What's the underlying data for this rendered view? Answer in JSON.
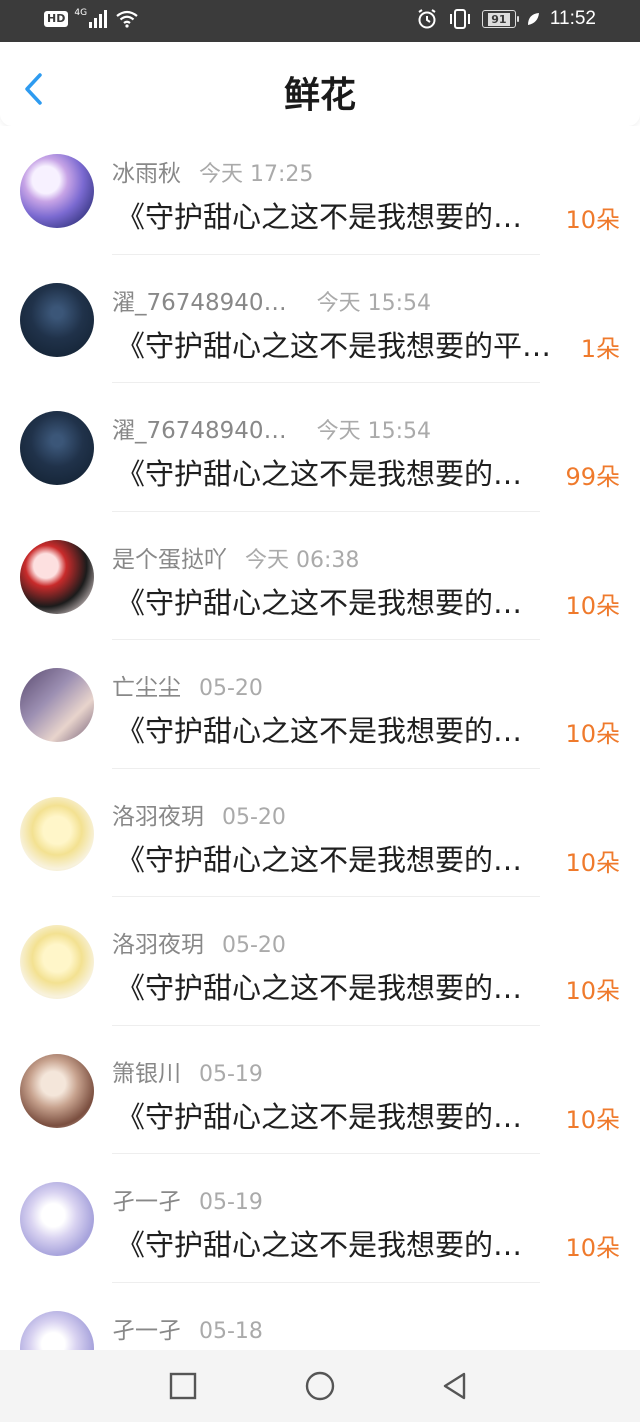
{
  "status_bar": {
    "hd": "HD",
    "network": "4G",
    "battery": "91",
    "time": "11:52"
  },
  "header": {
    "title": "鲜花"
  },
  "rows": [
    {
      "name": "冰雨秋",
      "time": "今天 17:25",
      "message": "《守护甜心之这不是我想要的…",
      "count": "10朵",
      "avatar": "av-1"
    },
    {
      "name": "濯_76748940…",
      "time": "今天 15:54",
      "message": "《守护甜心之这不是我想要的平…",
      "count": "1朵",
      "avatar": "av-2"
    },
    {
      "name": "濯_76748940…",
      "time": "今天 15:54",
      "message": "《守护甜心之这不是我想要的…",
      "count": "99朵",
      "avatar": "av-2"
    },
    {
      "name": "是个蛋挞吖",
      "time": "今天 06:38",
      "message": "《守护甜心之这不是我想要的…",
      "count": "10朵",
      "avatar": "av-3"
    },
    {
      "name": "亡尘尘",
      "time": "05-20",
      "message": "《守护甜心之这不是我想要的…",
      "count": "10朵",
      "avatar": "av-4"
    },
    {
      "name": "洛羽夜玥",
      "time": "05-20",
      "message": "《守护甜心之这不是我想要的…",
      "count": "10朵",
      "avatar": "av-5"
    },
    {
      "name": "洛羽夜玥",
      "time": "05-20",
      "message": "《守护甜心之这不是我想要的…",
      "count": "10朵",
      "avatar": "av-5"
    },
    {
      "name": "箫银川",
      "time": "05-19",
      "message": "《守护甜心之这不是我想要的…",
      "count": "10朵",
      "avatar": "av-6"
    },
    {
      "name": "孑一孑",
      "time": "05-19",
      "message": "《守护甜心之这不是我想要的…",
      "count": "10朵",
      "avatar": "av-7"
    },
    {
      "name": "孑一孑",
      "time": "05-18",
      "message": "",
      "count": "",
      "avatar": "av-7"
    }
  ],
  "colors": {
    "accent_blue": "#2e9bf0",
    "count_orange": "#ef7a2c",
    "status_bar_bg": "#3b3b3b",
    "nav_bar_bg": "#f4f4f4"
  },
  "icons": {
    "back": "chevron-left-icon",
    "nav_recent": "square-icon",
    "nav_home": "circle-icon",
    "nav_back": "triangle-left-icon"
  }
}
